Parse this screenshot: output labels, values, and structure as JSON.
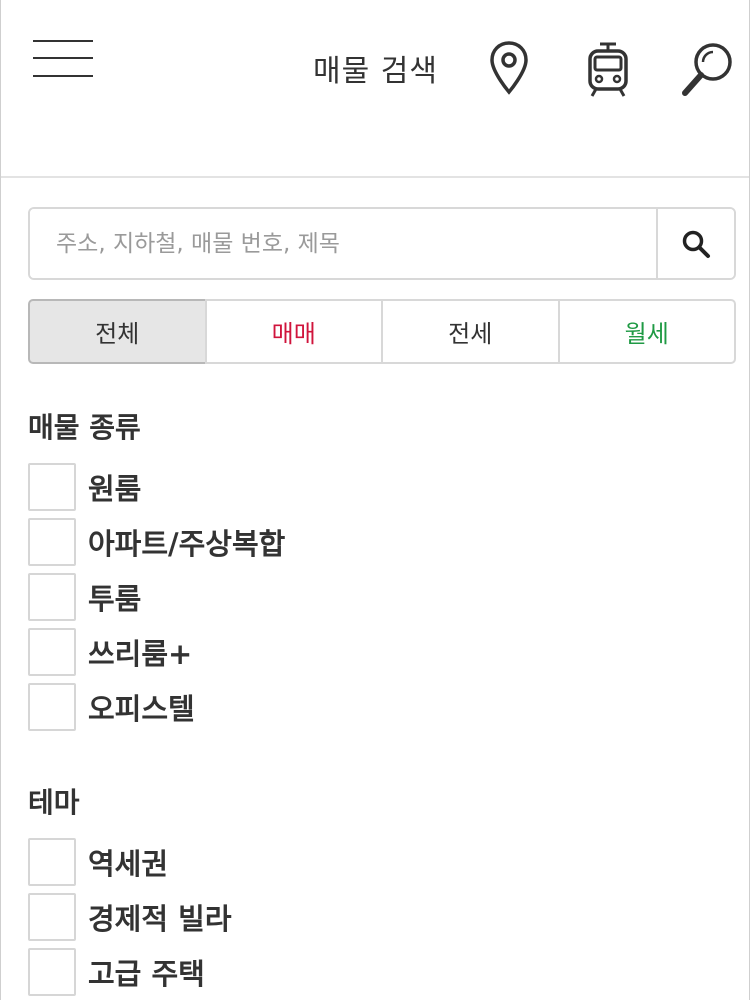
{
  "header": {
    "title": "매물 검색",
    "icons": [
      "menu-icon",
      "map-pin-icon",
      "train-icon",
      "magnifier-icon"
    ]
  },
  "search": {
    "placeholder": "주소, 지하철, 매물 번호, 제목",
    "value": ""
  },
  "deal_tabs": [
    {
      "label": "전체",
      "active": true,
      "color": "#333333"
    },
    {
      "label": "매매",
      "active": false,
      "color": "#d0143c"
    },
    {
      "label": "전세",
      "active": false,
      "color": "#333333"
    },
    {
      "label": "월세",
      "active": false,
      "color": "#1f9a44"
    }
  ],
  "property_type": {
    "title": "매물 종류",
    "items": [
      {
        "label": "원룸",
        "checked": false
      },
      {
        "label": "아파트/주상복합",
        "checked": false
      },
      {
        "label": "투룸",
        "checked": false
      },
      {
        "label": "쓰리룸+",
        "checked": false
      },
      {
        "label": "오피스텔",
        "checked": false
      }
    ]
  },
  "theme": {
    "title": "테마",
    "items": [
      {
        "label": "역세권",
        "checked": false
      },
      {
        "label": "경제적 빌라",
        "checked": false
      },
      {
        "label": "고급 주택",
        "checked": false
      }
    ]
  }
}
